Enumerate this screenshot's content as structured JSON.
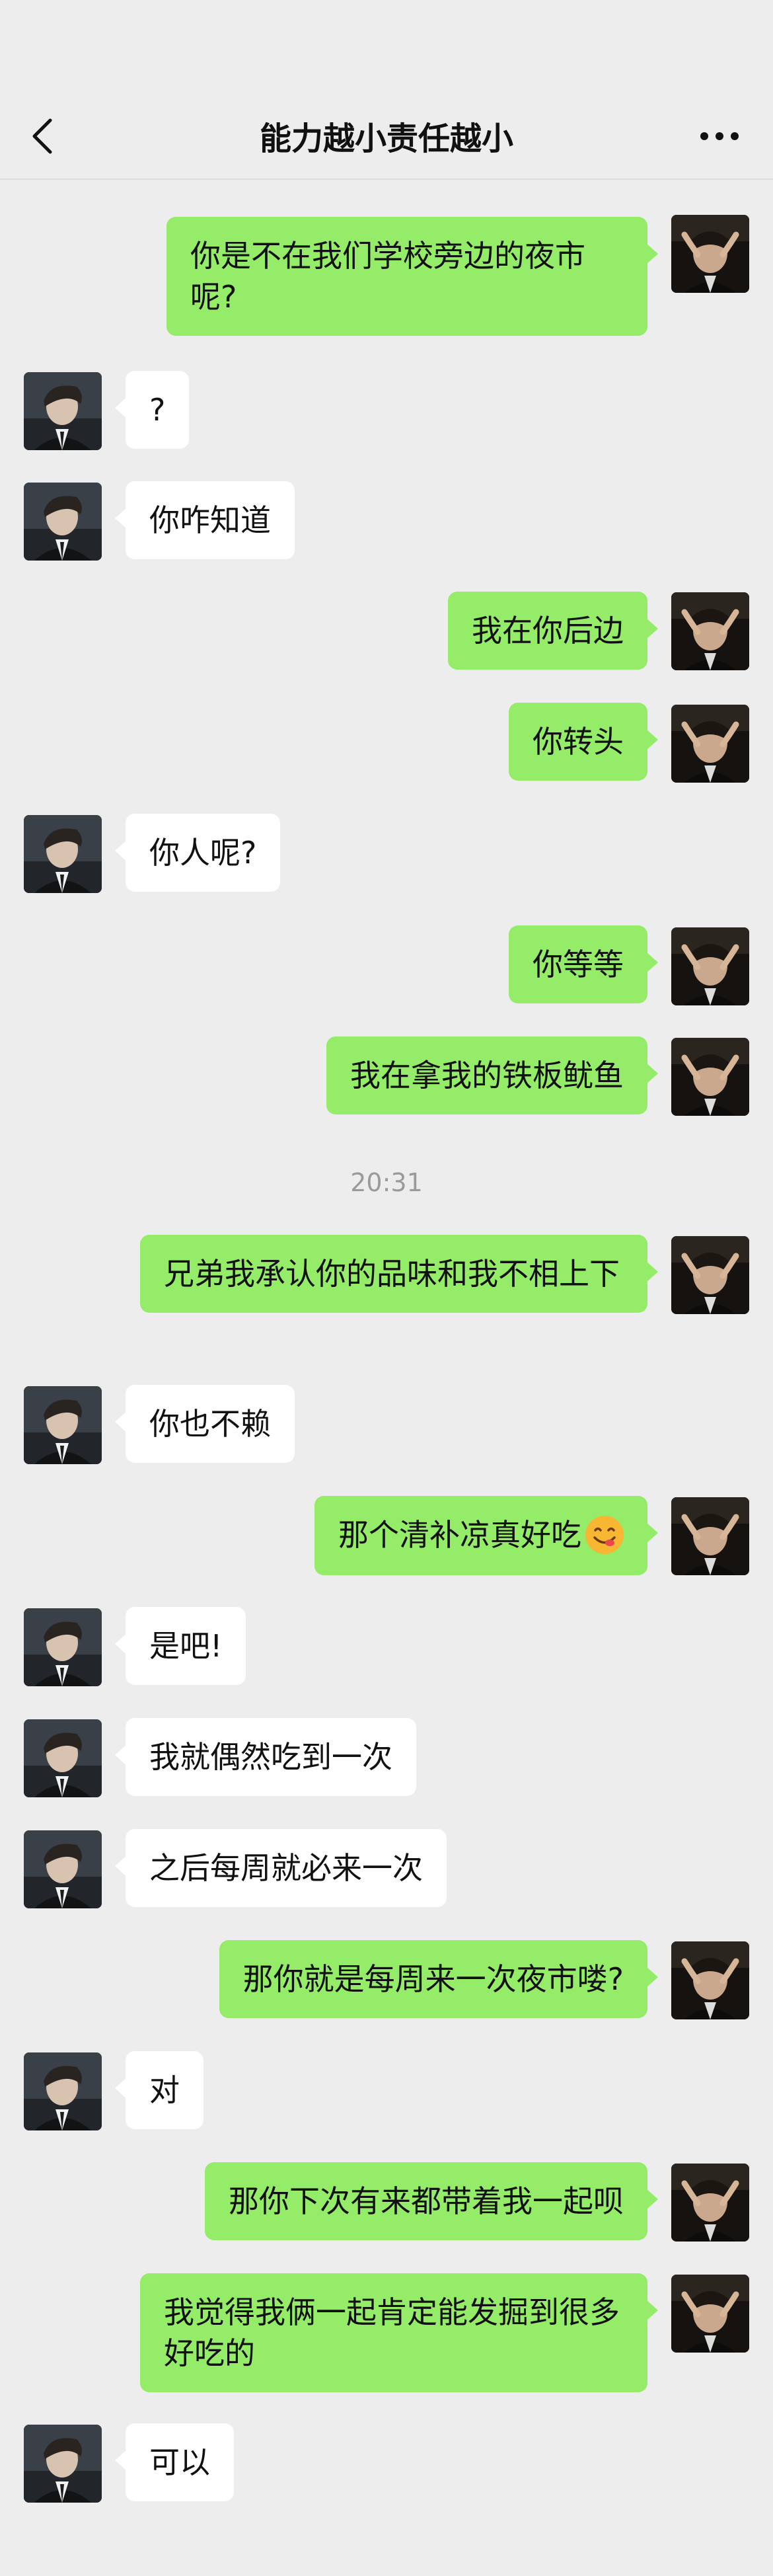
{
  "header": {
    "title": "能力越小责任越小"
  },
  "messages": [
    {
      "side": "out",
      "text": "你是不在我们学校旁边的夜市呢?"
    },
    {
      "side": "in",
      "text": "?"
    },
    {
      "side": "in",
      "text": "你咋知道"
    },
    {
      "side": "out",
      "text": "我在你后边"
    },
    {
      "side": "out",
      "text": "你转头"
    },
    {
      "side": "in",
      "text": "你人呢?"
    },
    {
      "side": "out",
      "text": "你等等"
    },
    {
      "side": "out",
      "text": "我在拿我的铁板鱿鱼"
    },
    {
      "side": "out",
      "text": "兄弟我承认你的品味和我不相上下"
    },
    {
      "side": "in",
      "text": "你也不赖"
    },
    {
      "side": "out",
      "text": "那个清补凉真好吃",
      "emoji": "yum-face-emoji"
    },
    {
      "side": "in",
      "text": "是吧!"
    },
    {
      "side": "in",
      "text": "我就偶然吃到一次"
    },
    {
      "side": "in",
      "text": "之后每周就必来一次"
    },
    {
      "side": "out",
      "text": "那你就是每周来一次夜市喽?"
    },
    {
      "side": "in",
      "text": "对"
    },
    {
      "side": "out",
      "text": "那你下次有来都带着我一起呗"
    },
    {
      "side": "out",
      "text": "我觉得我俩一起肯定能发掘到很多好吃的"
    },
    {
      "side": "in",
      "text": "可以"
    }
  ],
  "timestamp": "20:31",
  "colors": {
    "background": "#ededed",
    "outgoing_bubble": "#95ec69",
    "incoming_bubble": "#ffffff"
  },
  "icons": [
    "back-arrow-icon",
    "more-icon",
    "avatar-icon"
  ]
}
